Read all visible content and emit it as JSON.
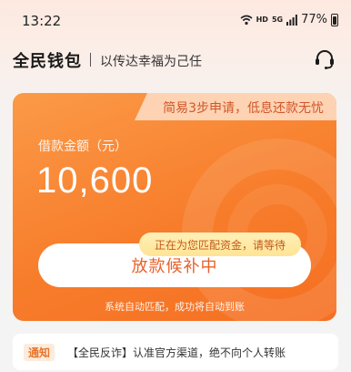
{
  "status_bar": {
    "time": "13:22",
    "network_hd": "HD",
    "network_5g": "5G",
    "battery": "77%",
    "icons": [
      "wifi-icon",
      "signal-icon",
      "battery-icon"
    ]
  },
  "header": {
    "brand": "全民钱包",
    "slogan": "以传达幸福为己任",
    "service_icon": "customer-service-icon"
  },
  "card": {
    "tab_text": "简易3步申请，低息还款无忧",
    "amount_label": "借款金额（元）",
    "amount_value": "10,600",
    "status_button_label": "放款候补中",
    "matching_tip": "正在为您匹配资金，请等待",
    "auto_note": "系统自动匹配，成功将自动到账"
  },
  "notice": {
    "tag": "通知",
    "text": "【全民反诈】认准官方渠道，绝不向个人转账"
  },
  "colors": {
    "accent": "#f77d2b",
    "button_text": "#e8612a",
    "tip_bg": "#ffe494"
  }
}
